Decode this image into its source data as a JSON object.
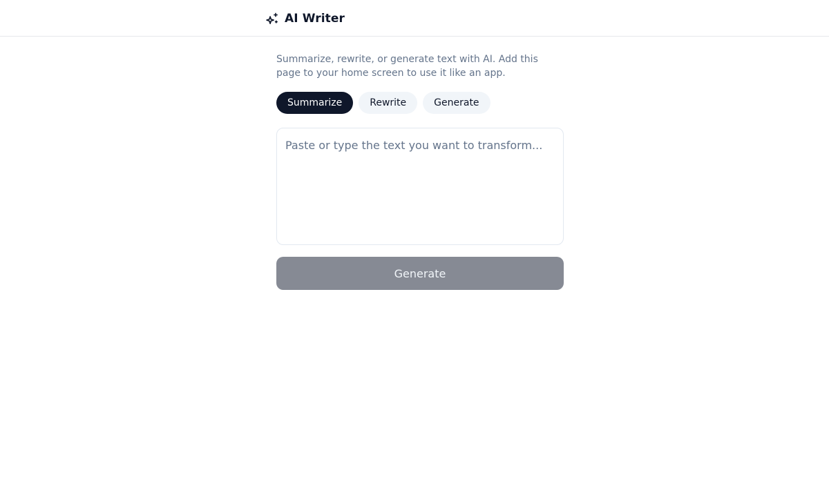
{
  "header": {
    "title": "AI Writer",
    "icon": "sparkles-icon"
  },
  "main": {
    "description": "Summarize, rewrite, or generate text with AI. Add this page to your home screen to use it like an app.",
    "modes": [
      {
        "label": "Summarize",
        "active": true
      },
      {
        "label": "Rewrite",
        "active": false
      },
      {
        "label": "Generate",
        "active": false
      }
    ],
    "input": {
      "value": "",
      "placeholder": "Paste or type the text you want to transform..."
    },
    "submit_label": "Generate",
    "submit_disabled": true
  },
  "colors": {
    "active_pill": "#0f172a",
    "inactive_pill": "#f1f5f9",
    "disabled_button": "#868a94",
    "muted_text": "#64748b",
    "border": "#e5e7eb"
  }
}
